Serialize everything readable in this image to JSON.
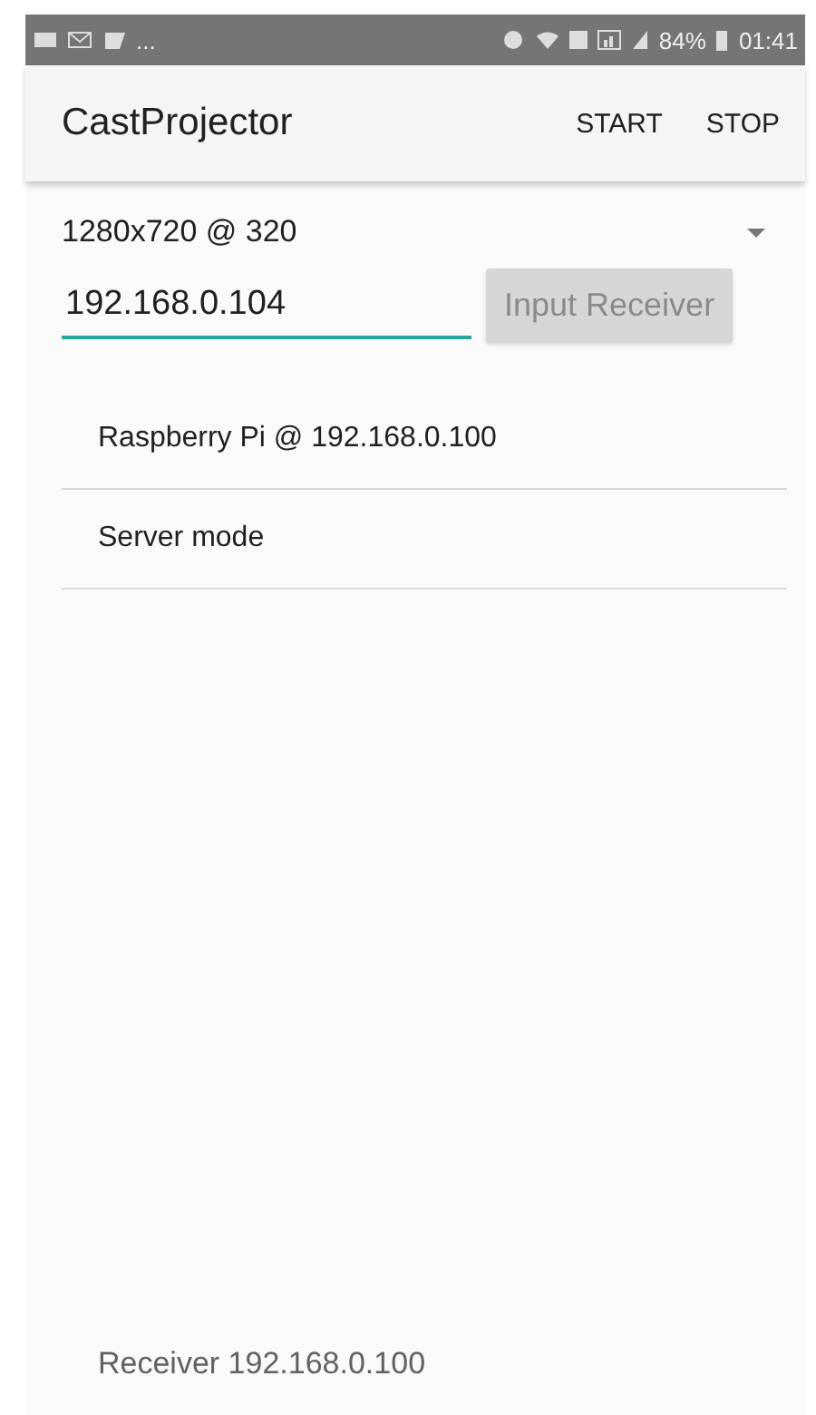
{
  "status_bar": {
    "more": "...",
    "battery": "84%",
    "time": "01:41"
  },
  "app_bar": {
    "title": "CastProjector",
    "actions": [
      "START",
      "STOP"
    ]
  },
  "resolution_dropdown": {
    "value": "1280x720 @ 320"
  },
  "receiver_field": {
    "value": "192.168.0.104",
    "focused": true
  },
  "input_button": {
    "label": "Input Receiver",
    "disabled": true
  },
  "list": [
    {
      "label": "Raspberry Pi @ 192.168.0.100"
    },
    {
      "label": "Server mode"
    }
  ],
  "footer": "Receiver 192.168.0.100"
}
